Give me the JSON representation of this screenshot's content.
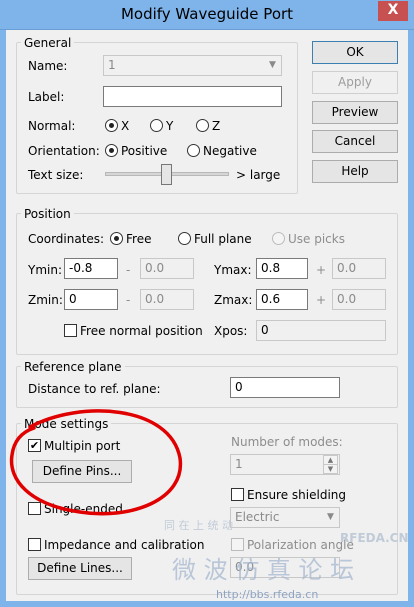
{
  "window": {
    "title": "Modify Waveguide Port",
    "close_glyph": "X"
  },
  "buttons": {
    "ok": "OK",
    "apply": "Apply",
    "preview": "Preview",
    "cancel": "Cancel",
    "help": "Help"
  },
  "general": {
    "title": "General",
    "name_label": "Name:",
    "name_value": "1",
    "label_label": "Label:",
    "label_value": "",
    "normal_label": "Normal:",
    "normal_options": [
      "X",
      "Y",
      "Z"
    ],
    "normal_selected": "X",
    "orientation_label": "Orientation:",
    "orientation_options": [
      "Positive",
      "Negative"
    ],
    "orientation_selected": "Positive",
    "textsize_label": "Text size:",
    "textsize_max_label": "> large"
  },
  "position": {
    "title": "Position",
    "coords_label": "Coordinates:",
    "coords_options": [
      "Free",
      "Full plane",
      "Use picks"
    ],
    "coords_selected": "Free",
    "ymin_label": "Ymin:",
    "ymin_value": "-0.8",
    "ymin_offset": "0.0",
    "ymax_label": "Ymax:",
    "ymax_value": "0.8",
    "ymax_offset": "0.0",
    "zmin_label": "Zmin:",
    "zmin_value": "0",
    "zmin_offset": "0.0",
    "zmax_label": "Zmax:",
    "zmax_value": "0.6",
    "zmax_offset": "0.0",
    "minus_sign": "-",
    "plus_sign": "+",
    "free_normal_label": "Free normal position",
    "xpos_label": "Xpos:",
    "xpos_value": "0"
  },
  "reference": {
    "title": "Reference plane",
    "distance_label": "Distance to ref. plane:",
    "distance_value": "0"
  },
  "mode": {
    "title": "Mode settings",
    "multipin_label": "Multipin port",
    "multipin_checked": true,
    "define_pins": "Define Pins...",
    "num_modes_label": "Number of modes:",
    "num_modes_value": "1",
    "ensure_shielding_label": "Ensure shielding",
    "single_ended_label": "Single-ended",
    "electric_value": "Electric",
    "impedance_label": "Impedance and calibration",
    "polarization_label": "Polarization angle",
    "polarization_value": "0.0",
    "define_lines": "Define Lines..."
  },
  "watermark": {
    "site_top": "RFEDA.CN",
    "chinese_small": "同 在 上 统 动",
    "chinese_big": "微 波 仿 真 论 坛",
    "url": "http://bbs.rfeda.cn"
  },
  "colors": {
    "titlebar": "#7eb4ea",
    "close": "#c75050",
    "annotation": "#e00000"
  }
}
